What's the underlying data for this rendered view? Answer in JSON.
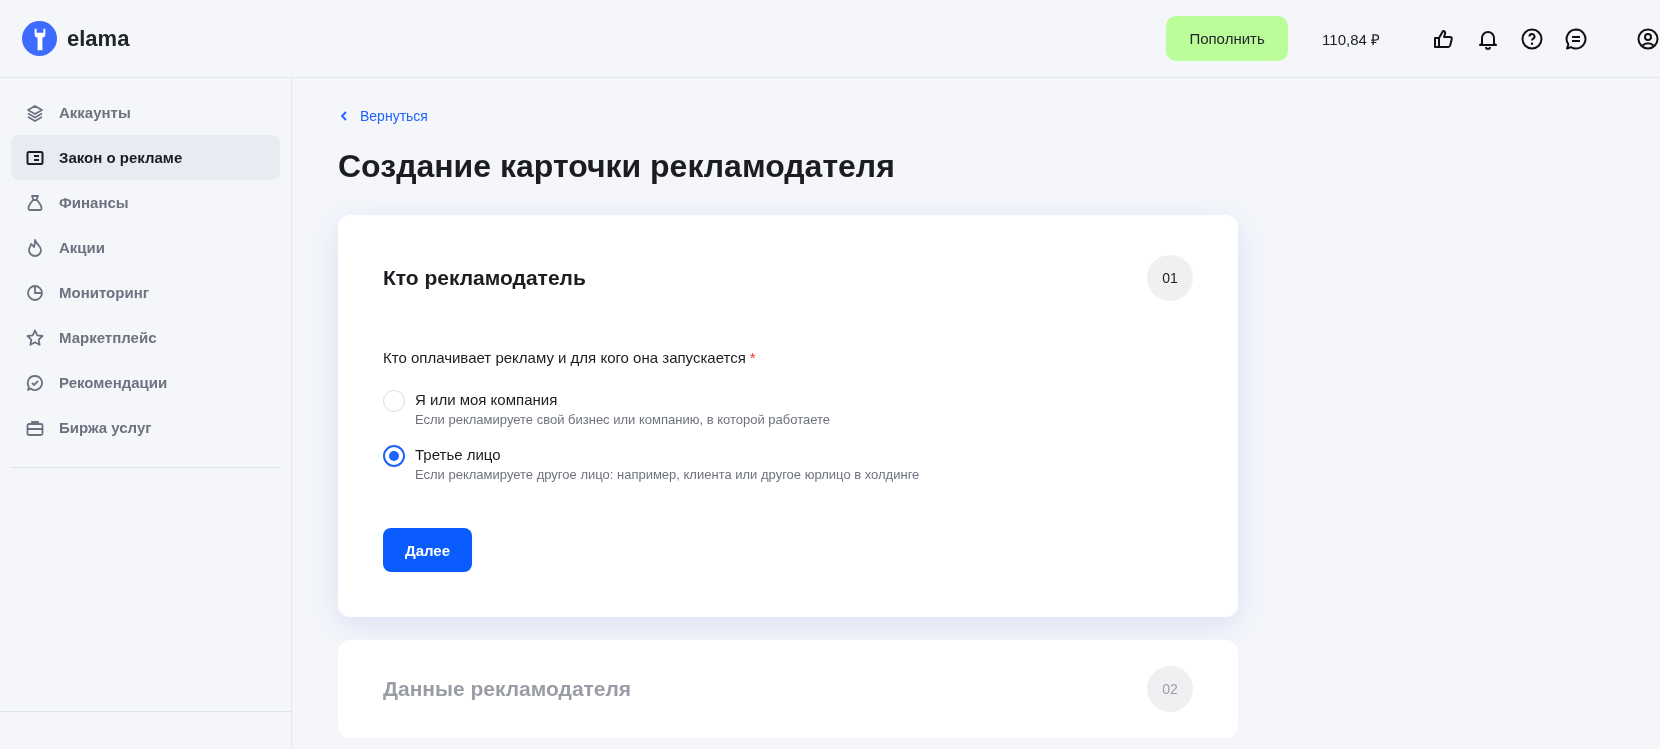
{
  "header": {
    "logo_text": "elama",
    "topup_button": "Пополнить",
    "balance": "110,84 ₽"
  },
  "sidebar": {
    "items": [
      {
        "label": "Аккаунты",
        "selected": false
      },
      {
        "label": "Закон о рекламе",
        "selected": true
      },
      {
        "label": "Финансы",
        "selected": false
      },
      {
        "label": "Акции",
        "selected": false
      },
      {
        "label": "Мониторинг",
        "selected": false
      },
      {
        "label": "Маркетплейс",
        "selected": false
      },
      {
        "label": "Рекомендации",
        "selected": false
      },
      {
        "label": "Биржа услуг",
        "selected": false
      }
    ]
  },
  "back_link": "Вернуться",
  "page_title": "Создание карточки рекламодателя",
  "steps": [
    {
      "title": "Кто рекламодатель",
      "number": "01",
      "active": true,
      "question": "Кто оплачивает рекламу и для кого она запускается",
      "required_mark": "*",
      "options": [
        {
          "label": "Я или моя компания",
          "hint": "Если рекламируете свой бизнес или компанию, в которой работаете",
          "selected": false
        },
        {
          "label": "Третье лицо",
          "hint": "Если рекламируете другое лицо: например, клиента или другое юрлицо в холдинге",
          "selected": true
        }
      ],
      "next_button": "Далее"
    },
    {
      "title": "Данные рекламодателя",
      "number": "02",
      "active": false
    }
  ]
}
